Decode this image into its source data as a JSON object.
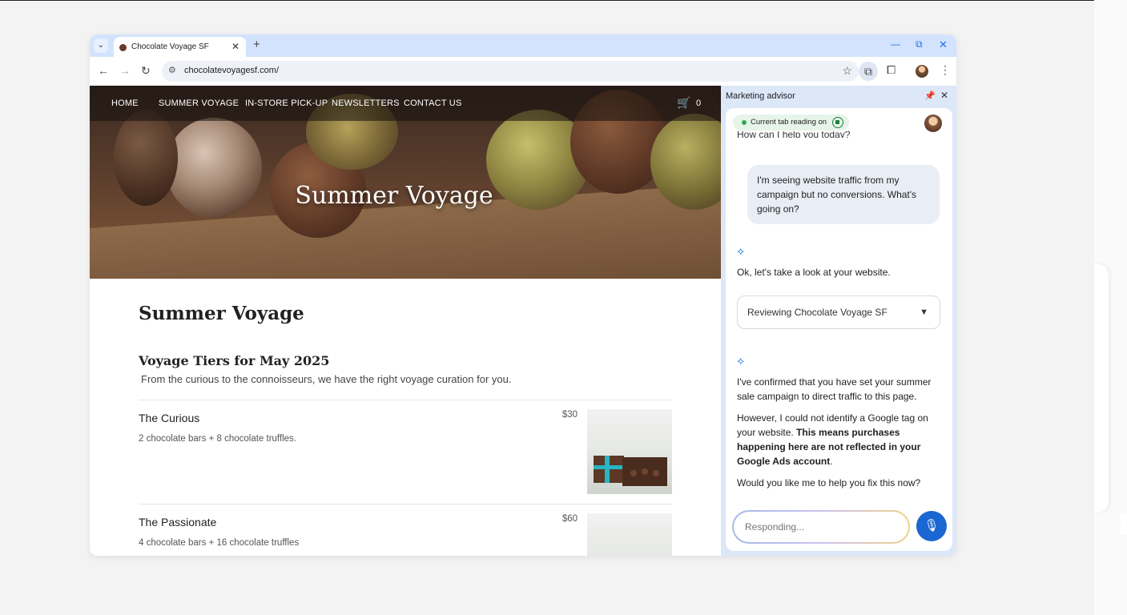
{
  "browser": {
    "tab_title": "Chocolate Voyage SF",
    "url": "chocolatevoyagesf.com/",
    "tab_close": "✕",
    "new_tab": "+"
  },
  "site": {
    "nav": [
      "HOME",
      "SUMMER VOYAGE",
      "IN-STORE PICK-UP",
      "NEWSLETTERS",
      "CONTACT US"
    ],
    "cart_count": "0",
    "hero_title": "Summer Voyage",
    "page_title": "Summer Voyage",
    "section_title": "Voyage Tiers for May 2025",
    "intro": "From the curious to the connoisseurs, we have the right voyage curation for you.",
    "tiers": [
      {
        "name": "The Curious",
        "desc": "2 chocolate bars + 8 chocolate truffles.",
        "price": "$30"
      },
      {
        "name": "The Passionate",
        "desc": "4 chocolate bars + 16 chocolate truffles",
        "price": "$60"
      }
    ]
  },
  "sidepanel": {
    "title": "Marketing advisor",
    "chip": "Current tab reading on",
    "cutoff_text": "How can I help you today?",
    "user_message": "I'm seeing website traffic from my campaign but no conversions. What's going on?",
    "ai_reply_1": "Ok, let's take a look at your website.",
    "review_label": "Reviewing Chocolate Voyage SF",
    "ai_reply_2": "I've confirmed that you have set your summer sale campaign to direct traffic to this page.",
    "ai_reply_3_plain": "However, I could not identify a Google tag on your website. ",
    "ai_reply_3_bold": "This means purchases happening here are not reflected in your Google Ads account",
    "ai_reply_3_end": ".",
    "ai_reply_4": "Would you like me to help you fix this now?",
    "input_placeholder": "Responding..."
  },
  "colors": {
    "accent": "#1a73e8",
    "tabstrip": "#d3e3fd",
    "status_green": "#34a853"
  }
}
